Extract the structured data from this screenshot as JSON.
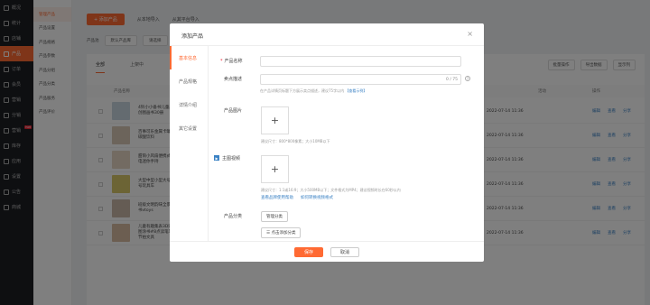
{
  "sidebar": {
    "items": [
      {
        "label": "概况"
      },
      {
        "label": "统计"
      },
      {
        "label": "店铺"
      },
      {
        "label": "产品"
      },
      {
        "label": "订单"
      },
      {
        "label": "会员"
      },
      {
        "label": "营销"
      },
      {
        "label": "分销"
      },
      {
        "label": "营销",
        "badge": "hot"
      },
      {
        "label": "库存"
      },
      {
        "label": "应用"
      },
      {
        "label": "设置"
      },
      {
        "label": "公告"
      },
      {
        "label": "商城"
      }
    ]
  },
  "subnav": {
    "items": [
      "管理产品",
      "产品设置",
      "产品规格",
      "产品参数",
      "产品分组",
      "产品分类",
      "产品服务",
      "产品评价"
    ]
  },
  "topbar": {
    "add_label": "+ 添加产品",
    "import_label": "从本地导入",
    "platform_label": "从其平台导入"
  },
  "filters": {
    "label": "产品池",
    "select1": "默认产品库",
    "select2": "请选择",
    "search": "搜索"
  },
  "tabs": [
    "全部",
    "上架中"
  ],
  "tools": [
    "批量操作",
    "导出数据",
    "显示列"
  ],
  "table": {
    "headers": [
      "产品名称",
      "",
      "",
      "",
      "",
      "",
      "",
      "",
      "活动",
      "操作"
    ],
    "rows": [
      {
        "name": "4铃小小备书儿童原创图画书30册",
        "date": "2022-07-14 11:36"
      },
      {
        "name": "百事可乐金属卡罐装碳酸饮料",
        "date": "2022-07-14 11:36"
      },
      {
        "name": "甜筒小风扇便携式充电迷你手持",
        "date": "2022-07-14 11:36"
      },
      {
        "name": "大型中型小型大号中号玩具车",
        "date": "2022-07-14 11:36"
      },
      {
        "name": "班级文明韵味全景图书vtoys",
        "date": "2022-07-14 11:36"
      },
      {
        "name": "儿童有趣集表3D贴图涂书#8点读笔等节拍文具",
        "category": "文具用品",
        "price": "¥0",
        "stock": "0",
        "date": "2022-07-14 11:36"
      }
    ],
    "ops": [
      "编辑",
      "查看",
      "分享"
    ]
  },
  "modal": {
    "title": "添加产品",
    "close": "×",
    "tabs": [
      "基本信息",
      "产品规格",
      "详情介绍",
      "其它设置"
    ],
    "fields": {
      "name_label": "产品名称",
      "desc_label": "卖点描述",
      "desc_count": "0 / 75",
      "desc_hint": "在产品详情页标题下方展示卖点描述，建议75字以内",
      "desc_link": "【查看示例】",
      "image_label": "产品图片",
      "image_hint": "建议尺寸：800*800像素；大小10MB以下",
      "video_label": "主图视频",
      "video_hint": "建议尺寸：1:1或16:9；大小500MB以下；文件格式为MP4；建议视频时长在60秒以内",
      "video_link1": "查看品牌使用帮助",
      "video_link2": "如何转换视频格式",
      "category_label": "产品分类",
      "category_btn": "管理分类",
      "category_add": "点击添加分类"
    },
    "save": "保存",
    "cancel": "取消"
  }
}
